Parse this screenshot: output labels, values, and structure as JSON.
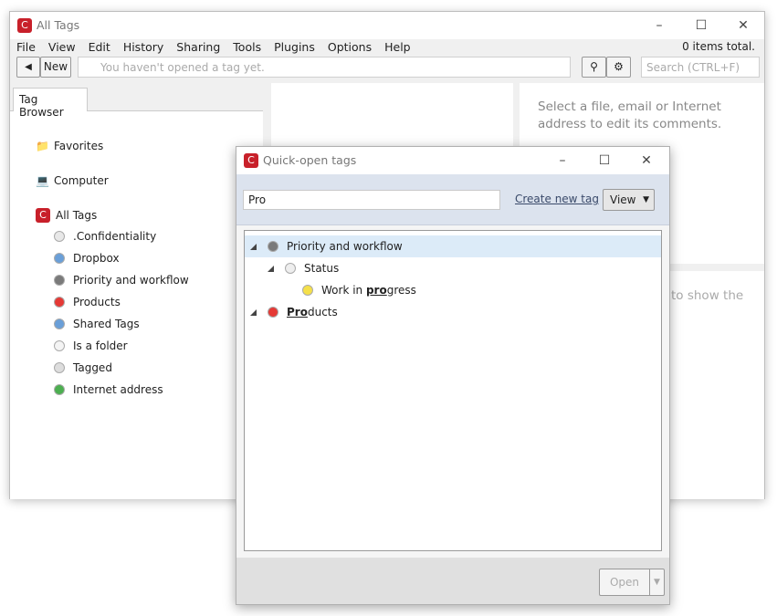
{
  "main_window": {
    "title": "All Tags",
    "menu": [
      "File",
      "View",
      "Edit",
      "History",
      "Sharing",
      "Tools",
      "Plugins",
      "Options",
      "Help"
    ],
    "items_total": "0 items total.",
    "new_label": "New",
    "address_placeholder": "You haven't opened a tag yet.",
    "search_placeholder": "Search (CTRL+F)",
    "tab_label": "Tag Browser",
    "roots": [
      {
        "label": "Favorites",
        "icon": "folder-star-icon"
      },
      {
        "label": "Computer",
        "icon": "computer-icon"
      },
      {
        "label": "All Tags",
        "icon": "app-logo-icon"
      }
    ],
    "tags": [
      {
        "label": ".Confidentiality",
        "color": "#e8e8e8"
      },
      {
        "label": "Dropbox",
        "color": "#6a9fd8"
      },
      {
        "label": "Priority and workflow",
        "color": "#7a7a7a"
      },
      {
        "label": "Products",
        "color": "#e53935"
      },
      {
        "label": "Shared Tags",
        "color": "#6a9fd8"
      },
      {
        "label": "Is a folder",
        "color": "#f4f4f4"
      },
      {
        "label": "Tagged",
        "color": "#ddd"
      },
      {
        "label": "Internet address",
        "color": "#4caf50"
      }
    ],
    "comments_hint": "Select a file, email or Internet address to edit its comments.",
    "preview_hint": "to show the"
  },
  "dialog": {
    "title": "Quick-open tags",
    "search_value": "Pro",
    "create_link": "Create new tag",
    "view_label": "View",
    "open_label": "Open",
    "tree": [
      {
        "pre": "",
        "match": "",
        "post": "Priority and workflow",
        "color": "#7a7a7a",
        "level": 0,
        "expanded": true,
        "selected": true
      },
      {
        "pre": "",
        "match": "",
        "post": "Status",
        "color": "#eeeeee",
        "level": 1,
        "expanded": true,
        "selected": false
      },
      {
        "pre": "Work in ",
        "match": "pro",
        "post": "gress",
        "color": "#f5e04a",
        "level": 2,
        "expanded": false,
        "selected": false
      },
      {
        "pre": "",
        "match": "Pro",
        "post": "ducts",
        "color": "#e53935",
        "level": 0,
        "expanded": true,
        "selected": false
      }
    ]
  }
}
